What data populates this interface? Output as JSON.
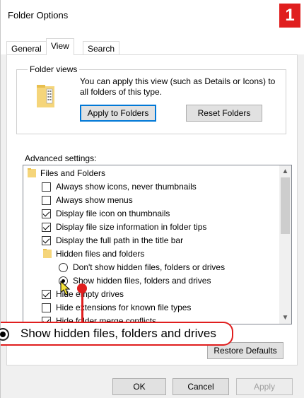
{
  "window": {
    "title": "Folder Options",
    "step_badge": "1"
  },
  "tabs": [
    {
      "label": "General"
    },
    {
      "label": "View"
    },
    {
      "label": "Search"
    }
  ],
  "folder_views": {
    "legend": "Folder views",
    "description": "You can apply this view (such as Details or Icons) to all folders of this type.",
    "apply_button": "Apply to Folders",
    "reset_button": "Reset Folders"
  },
  "advanced": {
    "label": "Advanced settings:",
    "items": [
      {
        "type": "folder",
        "label": "Files and Folders"
      },
      {
        "type": "checkbox",
        "checked": false,
        "label": "Always show icons, never thumbnails"
      },
      {
        "type": "checkbox",
        "checked": false,
        "label": "Always show menus"
      },
      {
        "type": "checkbox",
        "checked": true,
        "label": "Display file icon on thumbnails"
      },
      {
        "type": "checkbox",
        "checked": true,
        "label": "Display file size information in folder tips"
      },
      {
        "type": "checkbox",
        "checked": true,
        "label": "Display the full path in the title bar"
      },
      {
        "type": "folder",
        "label": "Hidden files and folders"
      },
      {
        "type": "radio",
        "checked": false,
        "label": "Don't show hidden files, folders or drives"
      },
      {
        "type": "radio",
        "checked": true,
        "label": "Show hidden files, folders and drives"
      },
      {
        "type": "checkbox",
        "checked": true,
        "label": "Hide empty drives"
      },
      {
        "type": "checkbox",
        "checked": false,
        "label": "Hide extensions for known file types"
      },
      {
        "type": "checkbox",
        "checked": true,
        "label": "Hide folder merge conflicts"
      }
    ],
    "restore_button": "Restore Defaults"
  },
  "callout": {
    "text": "Show hidden files, folders and drives"
  },
  "footer": {
    "ok": "OK",
    "cancel": "Cancel",
    "apply": "Apply"
  },
  "colors": {
    "accent_red": "#e01e1e",
    "focus_blue": "#0078d7"
  }
}
